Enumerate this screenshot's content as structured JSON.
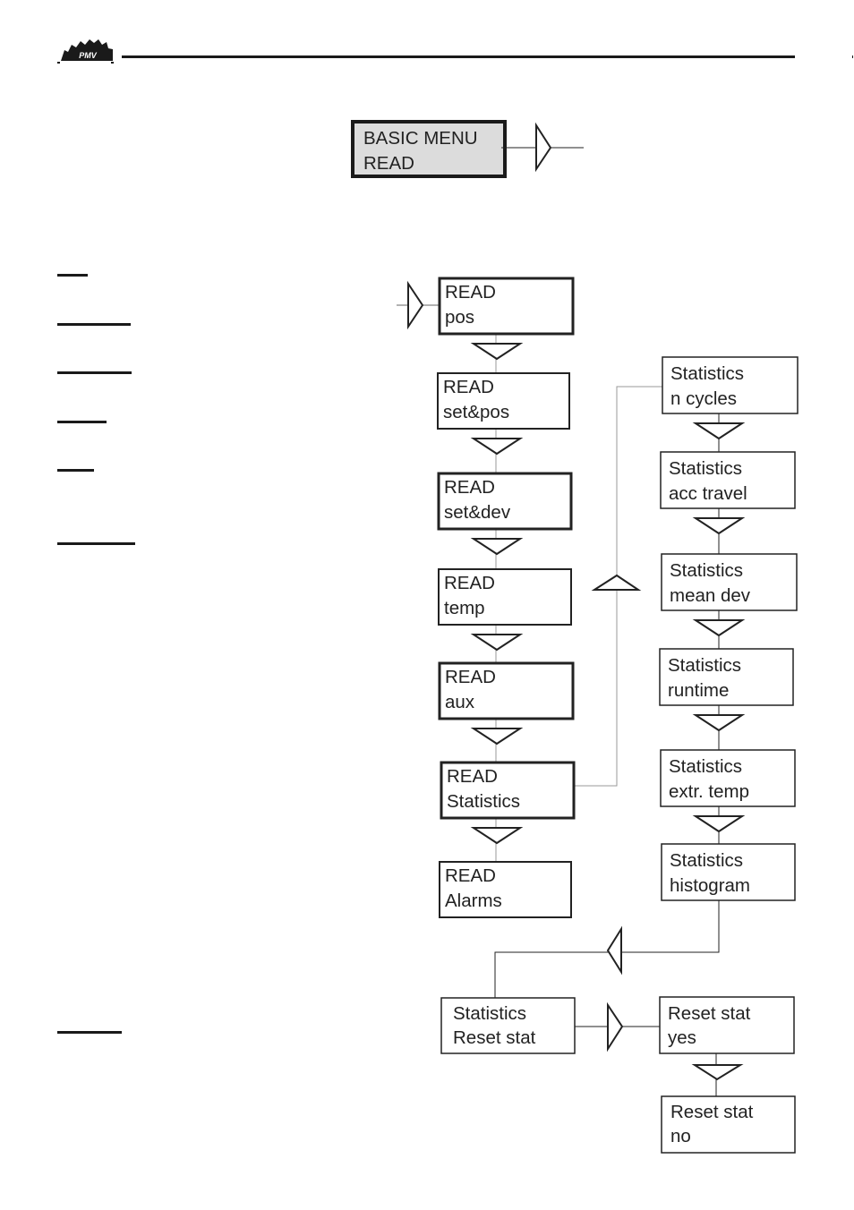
{
  "header": {
    "logo_text": "PMV"
  },
  "root_menu": {
    "line1": "BASIC MENU",
    "line2": "READ"
  },
  "read_menu": [
    {
      "line1": "READ",
      "line2": "pos"
    },
    {
      "line1": "READ",
      "line2": "set&pos"
    },
    {
      "line1": "READ",
      "line2": "set&dev"
    },
    {
      "line1": "READ",
      "line2": "temp"
    },
    {
      "line1": "READ",
      "line2": "aux"
    },
    {
      "line1": "READ",
      "line2": "Statistics"
    },
    {
      "line1": "READ",
      "line2": "Alarms"
    }
  ],
  "statistics_menu": [
    {
      "line1": "Statistics",
      "line2": "n cycles"
    },
    {
      "line1": "Statistics",
      "line2": "acc travel"
    },
    {
      "line1": "Statistics",
      "line2": "mean dev"
    },
    {
      "line1": "Statistics",
      "line2": "runtime"
    },
    {
      "line1": "Statistics",
      "line2": "extr. temp"
    },
    {
      "line1": "Statistics",
      "line2": "histogram"
    }
  ],
  "reset_menu": {
    "reset_stat": {
      "line1": "Statistics",
      "line2": "Reset stat"
    },
    "yes": {
      "line1": "Reset stat",
      "line2": "yes"
    },
    "no": {
      "line1": "Reset stat",
      "line2": "no"
    }
  },
  "colors": {
    "root_fill": "#dcdcdc",
    "stroke": "#222222",
    "connector": "#999999"
  }
}
